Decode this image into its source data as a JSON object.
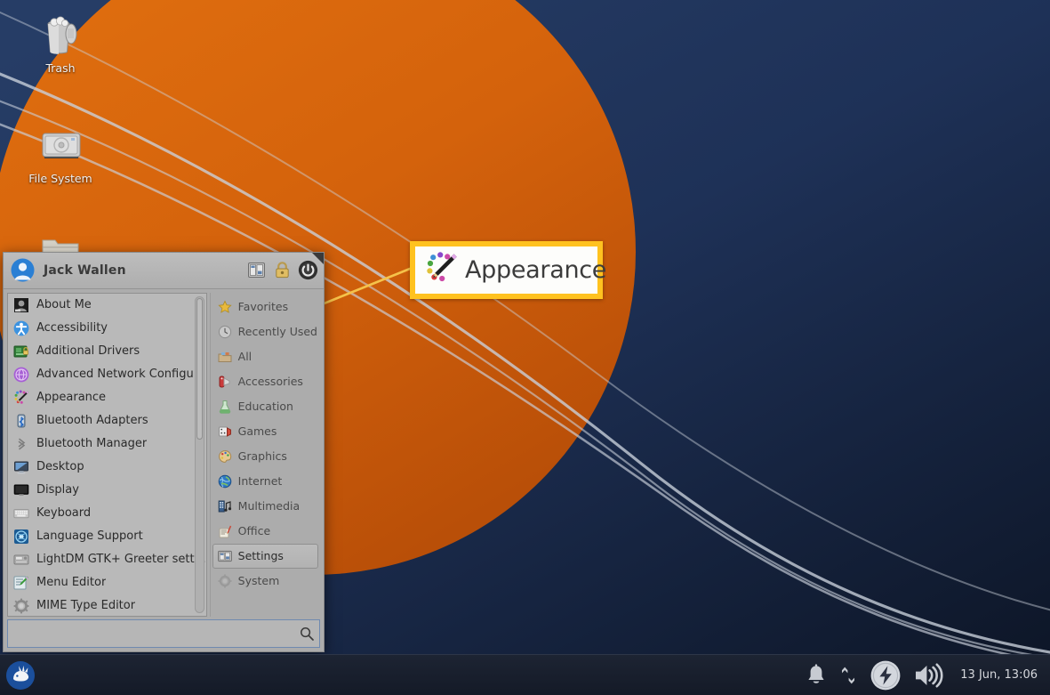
{
  "desktop": {
    "icons": [
      {
        "name": "trash",
        "label": "Trash"
      },
      {
        "name": "file-system",
        "label": "File System"
      },
      {
        "name": "home-folder",
        "label": ""
      }
    ],
    "wallpaper_colors": {
      "blue_dark": "#101b31",
      "blue_mid": "#24395f",
      "blue_light": "#2b4470",
      "orange": "#d4620c",
      "curve": "#c9cfd8"
    }
  },
  "menu": {
    "username": "Jack Wallen",
    "header_buttons": [
      {
        "name": "settings-manager",
        "label": "Settings Manager"
      },
      {
        "name": "lock-screen",
        "label": "Lock Screen"
      },
      {
        "name": "log-out",
        "label": "Log Out"
      }
    ],
    "apps": [
      {
        "label": "About Me",
        "icon": "about-me-icon"
      },
      {
        "label": "Accessibility",
        "icon": "accessibility-icon"
      },
      {
        "label": "Additional Drivers",
        "icon": "additional-drivers-icon"
      },
      {
        "label": "Advanced Network Configuration",
        "icon": "network-config-icon"
      },
      {
        "label": "Appearance",
        "icon": "appearance-icon"
      },
      {
        "label": "Bluetooth Adapters",
        "icon": "bluetooth-adapters-icon"
      },
      {
        "label": "Bluetooth Manager",
        "icon": "bluetooth-manager-icon"
      },
      {
        "label": "Desktop",
        "icon": "desktop-icon"
      },
      {
        "label": "Display",
        "icon": "display-icon"
      },
      {
        "label": "Keyboard",
        "icon": "keyboard-icon"
      },
      {
        "label": "Language Support",
        "icon": "language-support-icon"
      },
      {
        "label": "LightDM GTK+ Greeter settings",
        "icon": "lightdm-greeter-icon"
      },
      {
        "label": "Menu Editor",
        "icon": "menu-editor-icon"
      },
      {
        "label": "MIME Type Editor",
        "icon": "mime-type-editor-icon"
      }
    ],
    "categories": [
      {
        "label": "Favorites",
        "icon": "star-icon",
        "selected": false
      },
      {
        "label": "Recently Used",
        "icon": "clock-icon",
        "selected": false
      },
      {
        "label": "All",
        "icon": "all-icon",
        "selected": false
      },
      {
        "label": "Accessories",
        "icon": "accessories-icon",
        "selected": false
      },
      {
        "label": "Education",
        "icon": "education-icon",
        "selected": false
      },
      {
        "label": "Games",
        "icon": "games-icon",
        "selected": false
      },
      {
        "label": "Graphics",
        "icon": "graphics-icon",
        "selected": false
      },
      {
        "label": "Internet",
        "icon": "internet-icon",
        "selected": false
      },
      {
        "label": "Multimedia",
        "icon": "multimedia-icon",
        "selected": false
      },
      {
        "label": "Office",
        "icon": "office-icon",
        "selected": false
      },
      {
        "label": "Settings",
        "icon": "settings-icon",
        "selected": true
      },
      {
        "label": "System",
        "icon": "system-icon",
        "selected": false
      }
    ],
    "search": {
      "value": "",
      "placeholder": ""
    }
  },
  "callout": {
    "label": "Appearance",
    "border_color": "#ffc21f",
    "background_color": "#fdfdfb",
    "pointer_color": "#f5c24a"
  },
  "panel": {
    "launcher": {
      "name": "applications-menu",
      "label": "Applications"
    },
    "tray": [
      {
        "name": "notifications",
        "icon": "bell-icon"
      },
      {
        "name": "network",
        "icon": "network-updown-icon"
      },
      {
        "name": "power-manager",
        "icon": "power-bolt-icon"
      },
      {
        "name": "volume",
        "icon": "speaker-icon"
      }
    ],
    "clock": "13 Jun, 13:06"
  }
}
